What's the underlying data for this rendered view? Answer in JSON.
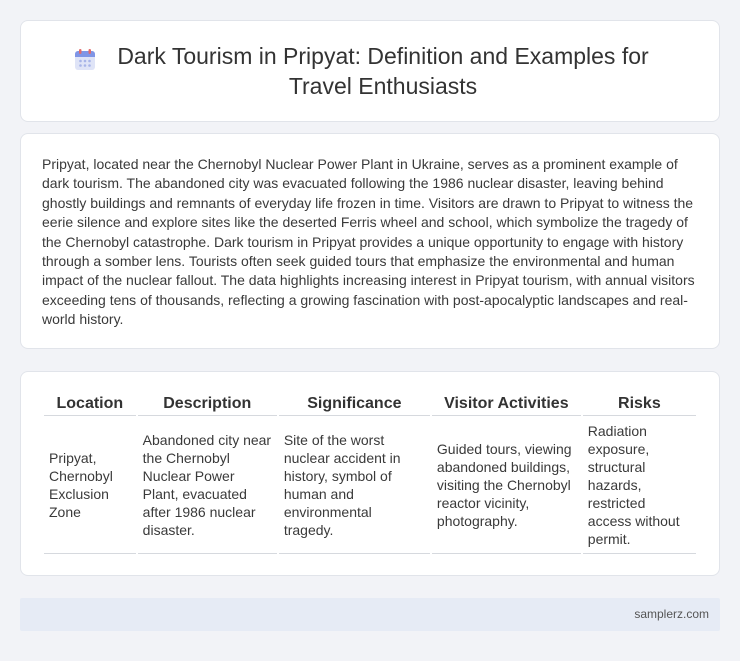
{
  "header": {
    "icon": "calendar-icon",
    "title": "Dark Tourism in Pripyat: Definition and Examples for Travel Enthusiasts"
  },
  "intro": {
    "text": "Pripyat, located near the Chernobyl Nuclear Power Plant in Ukraine, serves as a prominent example of dark tourism. The abandoned city was evacuated following the 1986 nuclear disaster, leaving behind ghostly buildings and remnants of everyday life frozen in time. Visitors are drawn to Pripyat to witness the eerie silence and explore sites like the deserted Ferris wheel and school, which symbolize the tragedy of the Chernobyl catastrophe. Dark tourism in Pripyat provides a unique opportunity to engage with history through a somber lens. Tourists often seek guided tours that emphasize the environmental and human impact of the nuclear fallout. The data highlights increasing interest in Pripyat tourism, with annual visitors exceeding tens of thousands, reflecting a growing fascination with post-apocalyptic landscapes and real-world history."
  },
  "table": {
    "headers": [
      "Location",
      "Description",
      "Significance",
      "Visitor Activities",
      "Risks"
    ],
    "rows": [
      [
        "Pripyat, Chernobyl Exclusion Zone",
        "Abandoned city near the Chernobyl Nuclear Power Plant, evacuated after 1986 nuclear disaster.",
        "Site of the worst nuclear accident in history, symbol of human and environmental tragedy.",
        "Guided tours, viewing abandoned buildings, visiting the Chernobyl reactor vicinity, photography.",
        "Radiation exposure, structural hazards, restricted access without permit."
      ]
    ]
  },
  "footer": {
    "site": "samplerz.com"
  }
}
